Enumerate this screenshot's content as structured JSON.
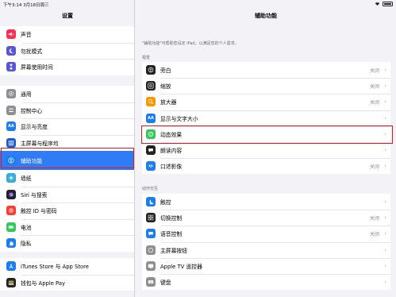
{
  "status_bar": {
    "time": "下午3:14 3月18日周三"
  },
  "sidebar": {
    "title": "设置",
    "group1": [
      {
        "label": "声音",
        "icon": "speaker-icon",
        "color": "#ff2d55"
      },
      {
        "label": "勿扰模式",
        "icon": "moon-icon",
        "color": "#5856d6"
      },
      {
        "label": "屏幕使用时间",
        "icon": "hourglass-icon",
        "color": "#5856d6"
      }
    ],
    "group2": [
      {
        "label": "通用",
        "icon": "gear-icon",
        "color": "#8e8e93"
      },
      {
        "label": "控制中心",
        "icon": "control-center-icon",
        "color": "#8e8e93"
      },
      {
        "label": "显示与亮度",
        "icon": "display-icon",
        "color": "#1c7cf2"
      },
      {
        "label": "主屏幕与程序坞",
        "icon": "home-screen-icon",
        "color": "#1c5bd6"
      },
      {
        "label": "辅助功能",
        "icon": "accessibility-icon",
        "color": "#1c7cf2",
        "selected": true
      },
      {
        "label": "墙纸",
        "icon": "wallpaper-icon",
        "color": "#34aadc"
      },
      {
        "label": "Siri 与搜索",
        "icon": "siri-icon",
        "color": "#222222"
      },
      {
        "label": "触控 ID 与密码",
        "icon": "fingerprint-icon",
        "color": "#ff3b30"
      },
      {
        "label": "电池",
        "icon": "battery-icon",
        "color": "#34c759"
      },
      {
        "label": "隐私",
        "icon": "hand-icon",
        "color": "#1c7cf2"
      }
    ],
    "group3": [
      {
        "label": "iTunes Store 与 App Store",
        "icon": "app-store-icon",
        "color": "#1c7cf2"
      },
      {
        "label": "钱包与 Apple Pay",
        "icon": "wallet-icon",
        "color": "#222222"
      }
    ]
  },
  "main": {
    "title": "辅助功能",
    "description": "\"辅助功能\"可帮助您设定 iPad，以满足您的个人需求。",
    "vision_header": "视觉",
    "vision": [
      {
        "label": "旁白",
        "value": "关闭",
        "icon": "voiceover-icon",
        "color": "#222222"
      },
      {
        "label": "缩放",
        "value": "关闭",
        "icon": "zoom-icon",
        "color": "#222222"
      },
      {
        "label": "放大器",
        "value": "关闭",
        "icon": "magnifier-icon",
        "color": "#ff9500"
      },
      {
        "label": "显示与文字大小",
        "value": "",
        "icon": "text-size-icon",
        "color": "#1c7cf2"
      },
      {
        "label": "动态效果",
        "value": "",
        "icon": "motion-icon",
        "color": "#34c759"
      },
      {
        "label": "朗读内容",
        "value": "",
        "icon": "speech-bubble-icon",
        "color": "#222222"
      },
      {
        "label": "口述影像",
        "value": "关闭",
        "icon": "audio-description-icon",
        "color": "#1c7cf2"
      }
    ],
    "interaction_header": "动作交互",
    "interaction": [
      {
        "label": "触控",
        "value": "",
        "icon": "touch-icon",
        "color": "#1c7cf2"
      },
      {
        "label": "切换控制",
        "value": "关闭",
        "icon": "switch-control-icon",
        "color": "#222222"
      },
      {
        "label": "语音控制",
        "value": "关闭",
        "icon": "voice-control-icon",
        "color": "#1c7cf2"
      },
      {
        "label": "主屏幕按钮",
        "value": "",
        "icon": "home-button-icon",
        "color": "#8e8e93"
      },
      {
        "label": "Apple TV 遥控器",
        "value": "",
        "icon": "remote-icon",
        "color": "#8e8e93"
      },
      {
        "label": "键盘",
        "value": "",
        "icon": "keyboard-icon",
        "color": "#8e8e93"
      }
    ]
  }
}
